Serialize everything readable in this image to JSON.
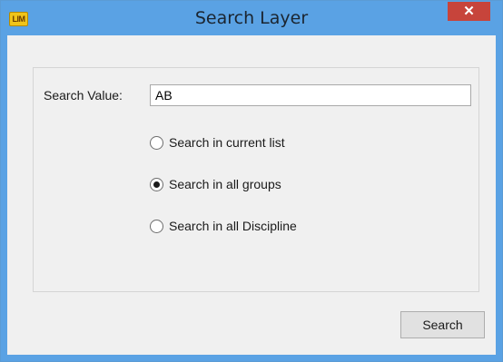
{
  "window": {
    "title": "Search Layer",
    "app_icon_text": "LIM",
    "close_glyph": "✕",
    "accent_color": "#5aa2e4",
    "close_color": "#c7443b"
  },
  "form": {
    "search_label": "Search Value:",
    "search_value": "AB",
    "options": [
      {
        "label": "Search in current list",
        "selected": false
      },
      {
        "label": "Search in all groups",
        "selected": true
      },
      {
        "label": "Search in all Discipline",
        "selected": false
      }
    ],
    "search_button": "Search"
  }
}
